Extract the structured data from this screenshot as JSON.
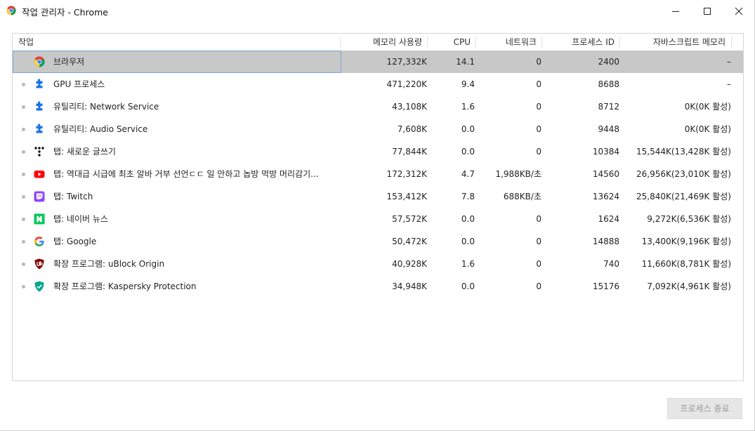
{
  "window": {
    "title": "작업 관리자 - Chrome"
  },
  "columns": {
    "task": "작업",
    "memory": "메모리 사용량",
    "cpu": "CPU",
    "network": "네트워크",
    "pid": "프로세스 ID",
    "js_memory": "자바스크립트 메모리"
  },
  "rows": [
    {
      "name": "브라우저",
      "icon": "chrome-icon",
      "memory": "127,332K",
      "cpu": "14.1",
      "network": "0",
      "pid": "2400",
      "js_memory": "–",
      "selected": true
    },
    {
      "name": "GPU 프로세스",
      "icon": "puzzle-icon",
      "memory": "471,220K",
      "cpu": "9.4",
      "network": "0",
      "pid": "8688",
      "js_memory": "–"
    },
    {
      "name": "유틸리티: Network Service",
      "icon": "puzzle-icon",
      "memory": "43,108K",
      "cpu": "1.6",
      "network": "0",
      "pid": "8712",
      "js_memory": "0K(0K 활성)"
    },
    {
      "name": "유틸리티: Audio Service",
      "icon": "puzzle-icon",
      "memory": "7,608K",
      "cpu": "0.0",
      "network": "0",
      "pid": "9448",
      "js_memory": "0K(0K 활성)"
    },
    {
      "name": "탭: 새로운 글쓰기",
      "icon": "dots-logo-icon",
      "memory": "77,844K",
      "cpu": "0.0",
      "network": "0",
      "pid": "10384",
      "js_memory": "15,544K(13,428K 활성)"
    },
    {
      "name": "탭: 역대급 시급에 최초 알바 거부 선언ㄷㄷ 일 안하고 놉방 먹방 머리감기...",
      "icon": "youtube-icon",
      "memory": "172,312K",
      "cpu": "4.7",
      "network": "1,988KB/초",
      "pid": "14560",
      "js_memory": "26,956K(23,010K 활성)"
    },
    {
      "name": "탭: Twitch",
      "icon": "twitch-icon",
      "memory": "153,412K",
      "cpu": "7.8",
      "network": "688KB/초",
      "pid": "13624",
      "js_memory": "25,840K(21,469K 활성)"
    },
    {
      "name": "탭: 네이버 뉴스",
      "icon": "naver-icon",
      "memory": "57,572K",
      "cpu": "0.0",
      "network": "0",
      "pid": "1624",
      "js_memory": "9,272K(6,536K 활성)"
    },
    {
      "name": "탭: Google",
      "icon": "google-icon",
      "memory": "50,472K",
      "cpu": "0.0",
      "network": "0",
      "pid": "14888",
      "js_memory": "13,400K(9,196K 활성)"
    },
    {
      "name": "확장 프로그램: uBlock Origin",
      "icon": "ublock-icon",
      "memory": "40,928K",
      "cpu": "1.6",
      "network": "0",
      "pid": "740",
      "js_memory": "11,660K(8,781K 활성)"
    },
    {
      "name": "확장 프로그램: Kaspersky Protection",
      "icon": "kaspersky-icon",
      "memory": "34,948K",
      "cpu": "0.0",
      "network": "0",
      "pid": "15176",
      "js_memory": "7,092K(4,961K 활성)"
    }
  ],
  "footer": {
    "end_process_label": "프로세스 종료"
  },
  "colors": {
    "selected_row": "#c8c8c8",
    "focus_outline": "#7aa7d8",
    "puzzle_blue": "#1a73e8",
    "youtube_red": "#ff0000",
    "twitch_purple": "#9146ff",
    "naver_green": "#03c75a",
    "ublock_red": "#800000",
    "kaspersky_teal": "#00a88e"
  }
}
